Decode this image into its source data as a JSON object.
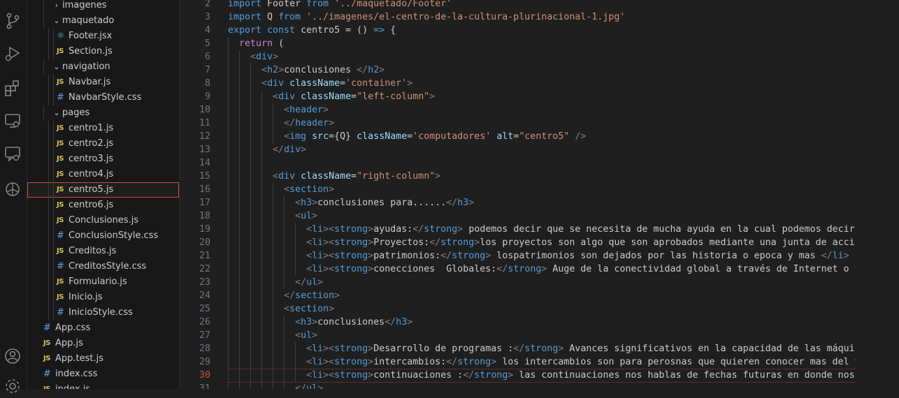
{
  "activity_bar": {
    "icons": [
      "source-control-icon",
      "run-debug-icon",
      "extensions-icon",
      "remote-explorer-icon",
      "comments-icon",
      "chatgpt-icon",
      "account-icon",
      "settings-gear-icon"
    ]
  },
  "explorer": {
    "items": [
      {
        "label": "imagenes",
        "type": "folder",
        "expanded": false,
        "depth": 1
      },
      {
        "label": "maquetado",
        "type": "folder",
        "expanded": true,
        "depth": 1
      },
      {
        "label": "Footer.jsx",
        "type": "jsx",
        "depth": 2
      },
      {
        "label": "Section.js",
        "type": "js",
        "depth": 2
      },
      {
        "label": "navigation",
        "type": "folder",
        "expanded": true,
        "depth": 1
      },
      {
        "label": "Navbar.js",
        "type": "js",
        "depth": 2
      },
      {
        "label": "NavbarStyle.css",
        "type": "css",
        "depth": 2
      },
      {
        "label": "pages",
        "type": "folder",
        "expanded": true,
        "depth": 1
      },
      {
        "label": "centro1.js",
        "type": "js",
        "depth": 2
      },
      {
        "label": "centro2.js",
        "type": "js",
        "depth": 2
      },
      {
        "label": "centro3.js",
        "type": "js",
        "depth": 2
      },
      {
        "label": "centro4.js",
        "type": "js",
        "depth": 2
      },
      {
        "label": "centro5.js",
        "type": "js",
        "depth": 2,
        "selected": true
      },
      {
        "label": "centro6.js",
        "type": "js",
        "depth": 2
      },
      {
        "label": "Conclusiones.js",
        "type": "js",
        "depth": 2
      },
      {
        "label": "ConclusionStyle.css",
        "type": "css",
        "depth": 2
      },
      {
        "label": "Creditos.js",
        "type": "js",
        "depth": 2
      },
      {
        "label": "CreditosStyle.css",
        "type": "css",
        "depth": 2
      },
      {
        "label": "Formulario.js",
        "type": "js",
        "depth": 2
      },
      {
        "label": "Inicio.js",
        "type": "js",
        "depth": 2
      },
      {
        "label": "InicioStyle.css",
        "type": "css",
        "depth": 2
      },
      {
        "label": "App.css",
        "type": "css",
        "depth": 0
      },
      {
        "label": "App.js",
        "type": "js",
        "depth": 0
      },
      {
        "label": "App.test.js",
        "type": "js",
        "depth": 0
      },
      {
        "label": "index.css",
        "type": "css",
        "depth": 0
      },
      {
        "label": "index.js",
        "type": "js",
        "depth": 0
      }
    ]
  },
  "editor": {
    "current_line": 30,
    "lines": [
      {
        "n": "2",
        "indent": 0,
        "tokens": [
          [
            "kw",
            "import "
          ],
          [
            "def",
            "Footer "
          ],
          [
            "kw",
            "from "
          ],
          [
            "str",
            "'../maquetado/Footer'"
          ]
        ]
      },
      {
        "n": "3",
        "indent": 0,
        "tokens": [
          [
            "kw",
            "import "
          ],
          [
            "def",
            "Q "
          ],
          [
            "kw",
            "from "
          ],
          [
            "str",
            "'../imagenes/el-centro-de-la-cultura-plurinacional-1.jpg'"
          ]
        ]
      },
      {
        "n": "4",
        "indent": 0,
        "tokens": [
          [
            "kw",
            "export const "
          ],
          [
            "def",
            "centro5 = () "
          ],
          [
            "kw",
            "=> "
          ],
          [
            "def",
            "{"
          ]
        ]
      },
      {
        "n": "5",
        "indent": 1,
        "tokens": [
          [
            "ret",
            "return "
          ],
          [
            "def",
            "("
          ]
        ]
      },
      {
        "n": "6",
        "indent": 2,
        "tokens": [
          [
            "pun",
            "<"
          ],
          [
            "tag",
            "div"
          ],
          [
            "pun",
            ">"
          ]
        ]
      },
      {
        "n": "7",
        "indent": 3,
        "tokens": [
          [
            "pun",
            "<"
          ],
          [
            "tag",
            "h2"
          ],
          [
            "pun",
            ">"
          ],
          [
            "def",
            "conclusiones "
          ],
          [
            "pun",
            "</"
          ],
          [
            "tag",
            "h2"
          ],
          [
            "pun",
            ">"
          ]
        ]
      },
      {
        "n": "8",
        "indent": 3,
        "tokens": [
          [
            "pun",
            "<"
          ],
          [
            "tag",
            "div "
          ],
          [
            "attr",
            "className"
          ],
          [
            "def",
            "="
          ],
          [
            "str",
            "'container'"
          ],
          [
            "pun",
            ">"
          ]
        ]
      },
      {
        "n": "9",
        "indent": 4,
        "tokens": [
          [
            "pun",
            "<"
          ],
          [
            "tag",
            "div "
          ],
          [
            "attr",
            "className"
          ],
          [
            "def",
            "="
          ],
          [
            "str",
            "\"left-column\""
          ],
          [
            "pun",
            ">"
          ]
        ]
      },
      {
        "n": "10",
        "indent": 5,
        "tokens": [
          [
            "pun",
            "<"
          ],
          [
            "tag",
            "header"
          ],
          [
            "pun",
            ">"
          ]
        ]
      },
      {
        "n": "11",
        "indent": 5,
        "tokens": [
          [
            "pun",
            "</"
          ],
          [
            "tag",
            "header"
          ],
          [
            "pun",
            ">"
          ]
        ]
      },
      {
        "n": "12",
        "indent": 5,
        "tokens": [
          [
            "pun",
            "<"
          ],
          [
            "tag",
            "img "
          ],
          [
            "attr",
            "src"
          ],
          [
            "def",
            "={Q} "
          ],
          [
            "attr",
            "className"
          ],
          [
            "def",
            "="
          ],
          [
            "str",
            "'computadores' "
          ],
          [
            "attr",
            "alt"
          ],
          [
            "def",
            "="
          ],
          [
            "str",
            "\"centro5\" "
          ],
          [
            "pun",
            "/>"
          ]
        ]
      },
      {
        "n": "13",
        "indent": 4,
        "tokens": [
          [
            "pun",
            "</"
          ],
          [
            "tag",
            "div"
          ],
          [
            "pun",
            ">"
          ]
        ]
      },
      {
        "n": "14",
        "indent": 4,
        "tokens": []
      },
      {
        "n": "15",
        "indent": 4,
        "tokens": [
          [
            "pun",
            "<"
          ],
          [
            "tag",
            "div "
          ],
          [
            "attr",
            "className"
          ],
          [
            "def",
            "="
          ],
          [
            "str",
            "\"right-column\""
          ],
          [
            "pun",
            ">"
          ]
        ]
      },
      {
        "n": "16",
        "indent": 5,
        "tokens": [
          [
            "pun",
            "<"
          ],
          [
            "tag",
            "section"
          ],
          [
            "pun",
            ">"
          ]
        ]
      },
      {
        "n": "17",
        "indent": 6,
        "tokens": [
          [
            "pun",
            "<"
          ],
          [
            "tag",
            "h3"
          ],
          [
            "pun",
            ">"
          ],
          [
            "def",
            "conclusiones para......"
          ],
          [
            "pun",
            "</"
          ],
          [
            "tag",
            "h3"
          ],
          [
            "pun",
            ">"
          ]
        ]
      },
      {
        "n": "18",
        "indent": 6,
        "tokens": [
          [
            "pun",
            "<"
          ],
          [
            "tag",
            "ul"
          ],
          [
            "pun",
            ">"
          ]
        ]
      },
      {
        "n": "19",
        "indent": 7,
        "tokens": [
          [
            "pun",
            "<"
          ],
          [
            "tag",
            "li"
          ],
          [
            "pun",
            "><"
          ],
          [
            "tag",
            "strong"
          ],
          [
            "pun",
            ">"
          ],
          [
            "def",
            "ayudas:"
          ],
          [
            "pun",
            "</"
          ],
          [
            "tag",
            "strong"
          ],
          [
            "pun",
            "> "
          ],
          [
            "def",
            "podemos decir que se necesita de mucha ayuda en la cual podemos decir"
          ]
        ]
      },
      {
        "n": "20",
        "indent": 7,
        "tokens": [
          [
            "pun",
            "<"
          ],
          [
            "tag",
            "li"
          ],
          [
            "pun",
            "><"
          ],
          [
            "tag",
            "strong"
          ],
          [
            "pun",
            ">"
          ],
          [
            "def",
            "Proyectos:"
          ],
          [
            "pun",
            "</"
          ],
          [
            "tag",
            "strong"
          ],
          [
            "pun",
            ">"
          ],
          [
            "def",
            "los proyectos son algo que son aprobados mediante una junta de acci"
          ]
        ]
      },
      {
        "n": "21",
        "indent": 7,
        "tokens": [
          [
            "pun",
            "<"
          ],
          [
            "tag",
            "li"
          ],
          [
            "pun",
            "><"
          ],
          [
            "tag",
            "strong"
          ],
          [
            "pun",
            ">"
          ],
          [
            "def",
            "patrimonios:"
          ],
          [
            "pun",
            "</"
          ],
          [
            "tag",
            "strong"
          ],
          [
            "pun",
            "> "
          ],
          [
            "def",
            "lospatrimonios son dejados por las historia o epoca y mas "
          ],
          [
            "pun",
            "</"
          ],
          [
            "tag",
            "li"
          ],
          [
            "pun",
            ">"
          ]
        ]
      },
      {
        "n": "22",
        "indent": 7,
        "tokens": [
          [
            "pun",
            "<"
          ],
          [
            "tag",
            "li"
          ],
          [
            "pun",
            "><"
          ],
          [
            "tag",
            "strong"
          ],
          [
            "pun",
            ">"
          ],
          [
            "def",
            "conecciones  Globales:"
          ],
          [
            "pun",
            "</"
          ],
          [
            "tag",
            "strong"
          ],
          [
            "pun",
            "> "
          ],
          [
            "def",
            "Auge de la conectividad global a través de Internet o ."
          ]
        ]
      },
      {
        "n": "23",
        "indent": 6,
        "tokens": [
          [
            "pun",
            "</"
          ],
          [
            "tag",
            "ul"
          ],
          [
            "pun",
            ">"
          ]
        ]
      },
      {
        "n": "24",
        "indent": 5,
        "tokens": [
          [
            "pun",
            "</"
          ],
          [
            "tag",
            "section"
          ],
          [
            "pun",
            ">"
          ]
        ]
      },
      {
        "n": "25",
        "indent": 5,
        "tokens": [
          [
            "pun",
            "<"
          ],
          [
            "tag",
            "section"
          ],
          [
            "pun",
            ">"
          ]
        ]
      },
      {
        "n": "26",
        "indent": 6,
        "tokens": [
          [
            "pun",
            "<"
          ],
          [
            "tag",
            "h3"
          ],
          [
            "pun",
            ">"
          ],
          [
            "def",
            "conclusiones"
          ],
          [
            "pun",
            "</"
          ],
          [
            "tag",
            "h3"
          ],
          [
            "pun",
            ">"
          ]
        ]
      },
      {
        "n": "27",
        "indent": 6,
        "tokens": [
          [
            "pun",
            "<"
          ],
          [
            "tag",
            "ul"
          ],
          [
            "pun",
            ">"
          ]
        ]
      },
      {
        "n": "28",
        "indent": 7,
        "tokens": [
          [
            "pun",
            "<"
          ],
          [
            "tag",
            "li"
          ],
          [
            "pun",
            "><"
          ],
          [
            "tag",
            "strong"
          ],
          [
            "pun",
            ">"
          ],
          [
            "def",
            "Desarrollo de programas :"
          ],
          [
            "pun",
            "</"
          ],
          [
            "tag",
            "strong"
          ],
          [
            "pun",
            "> "
          ],
          [
            "def",
            "Avances significativos en la capacidad de las máquir"
          ]
        ]
      },
      {
        "n": "29",
        "indent": 7,
        "tokens": [
          [
            "pun",
            "<"
          ],
          [
            "tag",
            "li"
          ],
          [
            "pun",
            "><"
          ],
          [
            "tag",
            "strong"
          ],
          [
            "pun",
            ">"
          ],
          [
            "def",
            "intercambios:"
          ],
          [
            "pun",
            "</"
          ],
          [
            "tag",
            "strong"
          ],
          [
            "pun",
            "> "
          ],
          [
            "def",
            "los intercambios son para perosnas que quieren conocer mas del t"
          ]
        ]
      },
      {
        "n": "30",
        "indent": 7,
        "tokens": [
          [
            "pun",
            "<"
          ],
          [
            "tag",
            "li"
          ],
          [
            "pun",
            "><"
          ],
          [
            "tag",
            "strong"
          ],
          [
            "pun",
            ">"
          ],
          [
            "def",
            "continuaciones :"
          ],
          [
            "pun",
            "</"
          ],
          [
            "tag",
            "strong"
          ],
          [
            "pun",
            "> "
          ],
          [
            "def",
            "las continuaciones nos hablas de fechas futuras en donde nos"
          ]
        ]
      },
      {
        "n": "31",
        "indent": 6,
        "tokens": [
          [
            "pun",
            "</"
          ],
          [
            "tag",
            "ul"
          ],
          [
            "pun",
            ">"
          ]
        ]
      }
    ]
  }
}
